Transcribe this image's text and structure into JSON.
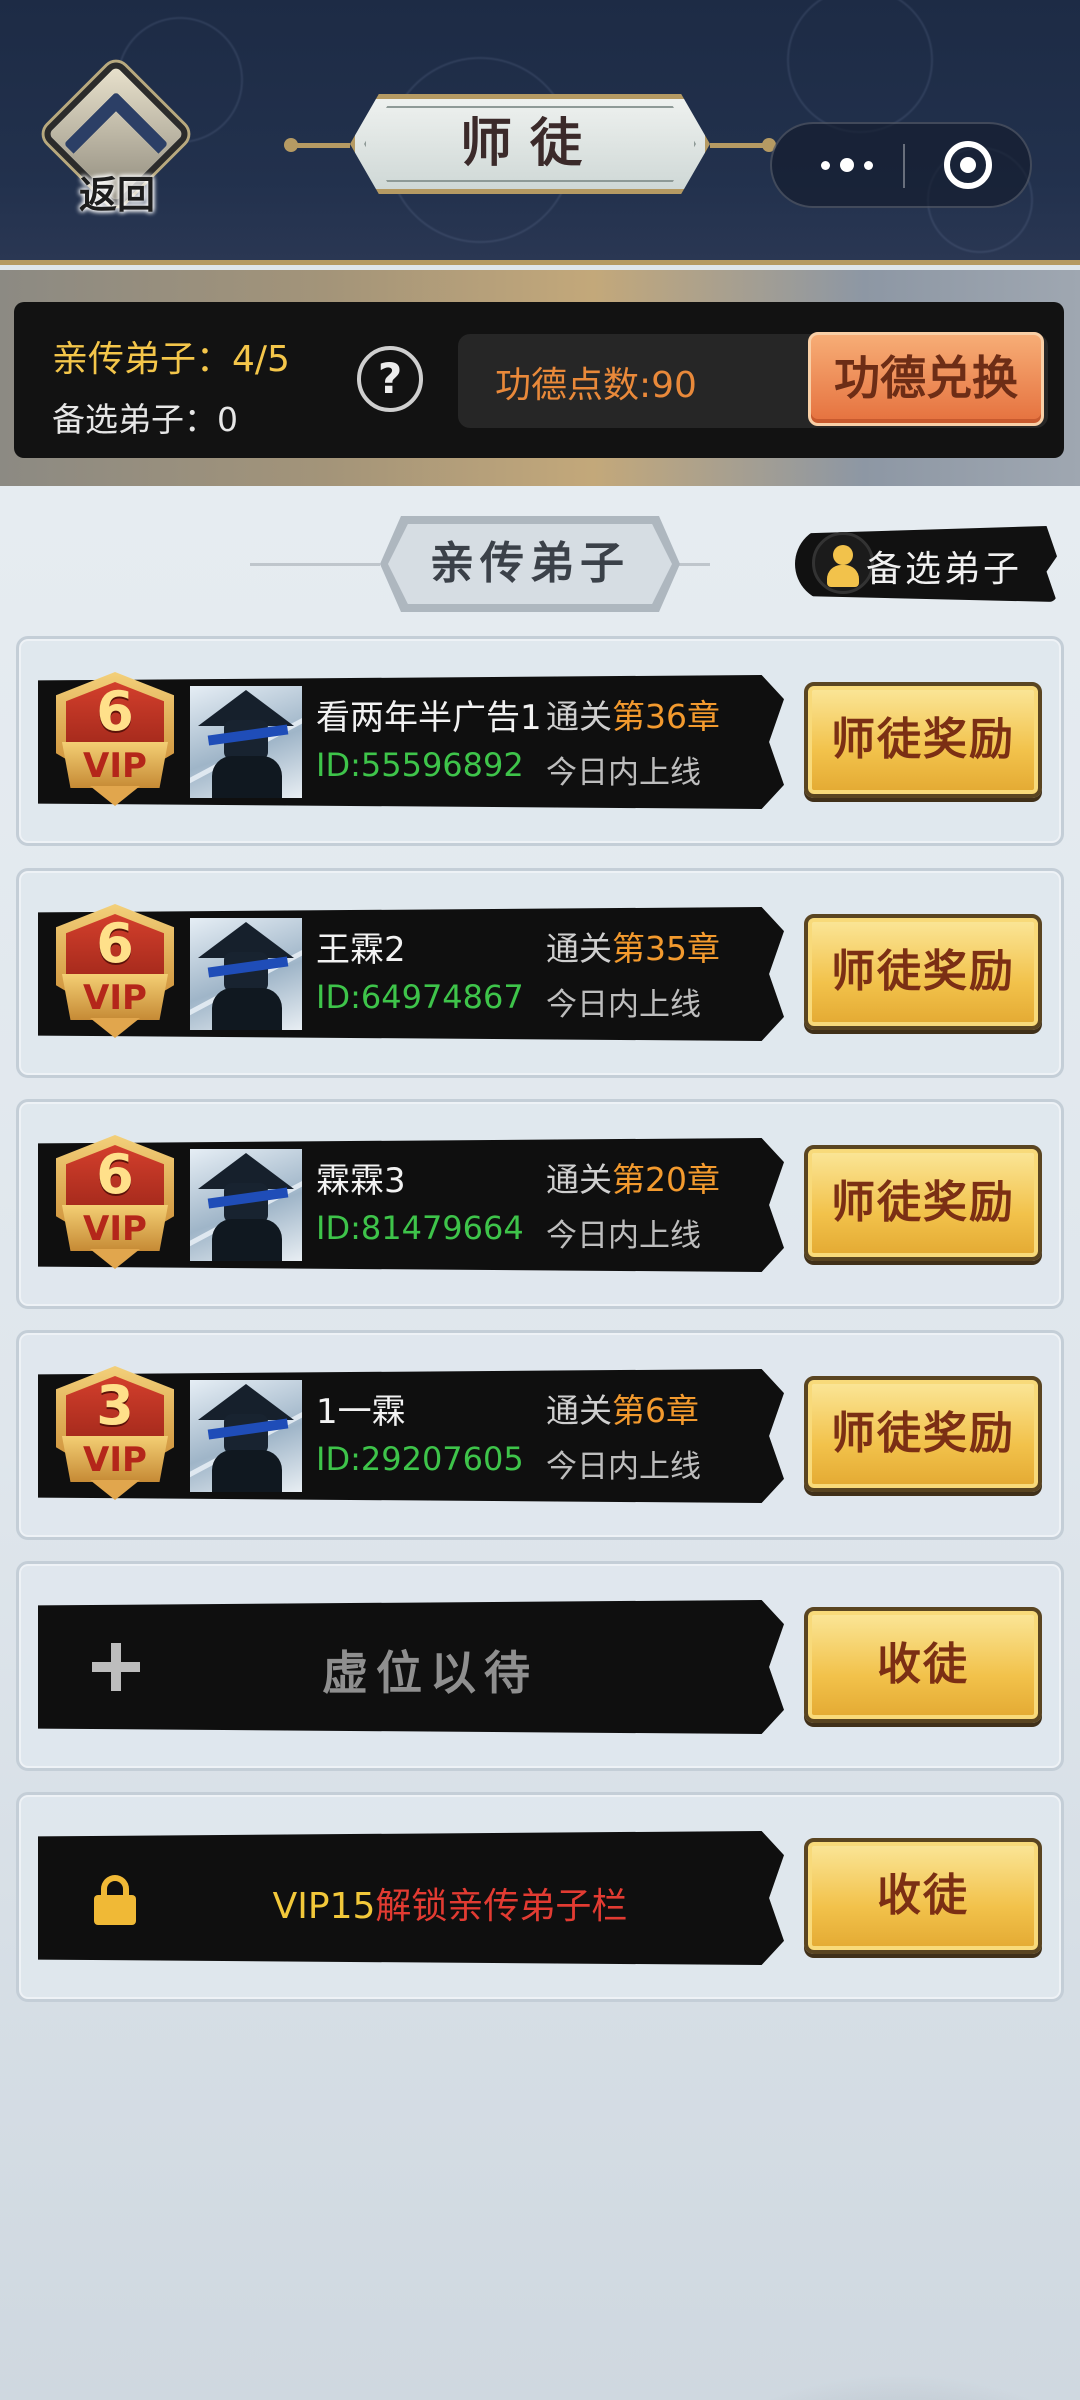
{
  "header": {
    "back_label": "返回",
    "title": "师徒"
  },
  "info": {
    "direct_label": "亲传弟子：",
    "direct_count": "4/5",
    "standby_label": "备选弟子：",
    "standby_count": "0",
    "help": "?",
    "merit_label": "功德点数:",
    "merit_value": "90",
    "exchange_button": "功德兑换"
  },
  "section": {
    "title": "亲传弟子",
    "standby_button": "备选弟子"
  },
  "disciples": [
    {
      "vip_level": "6",
      "vip_text": "VIP",
      "name": "看两年半广告1",
      "id": "ID:55596892",
      "progress_prefix": "通关",
      "chapter": "第36章",
      "online": "今日内上线",
      "button": "师徒奖励"
    },
    {
      "vip_level": "6",
      "vip_text": "VIP",
      "name": "王霖2",
      "id": "ID:64974867",
      "progress_prefix": "通关",
      "chapter": "第35章",
      "online": "今日内上线",
      "button": "师徒奖励"
    },
    {
      "vip_level": "6",
      "vip_text": "VIP",
      "name": "霖霖3",
      "id": "ID:81479664",
      "progress_prefix": "通关",
      "chapter": "第20章",
      "online": "今日内上线",
      "button": "师徒奖励"
    },
    {
      "vip_level": "3",
      "vip_text": "VIP",
      "name": "1一霖",
      "id": "ID:29207605",
      "progress_prefix": "通关",
      "chapter": "第6章",
      "online": "今日内上线",
      "button": "师徒奖励"
    }
  ],
  "empty_slot": {
    "text": "虚位以待",
    "button": "收徒"
  },
  "locked_slot": {
    "vip": "VIP15",
    "text": "解锁亲传弟子栏",
    "button": "收徒"
  },
  "colors": {
    "header_bg": "#1d2b45",
    "gold": "#f2c24b",
    "green_id": "#3ec44a",
    "orange_chapter": "#f39a2e",
    "exchange_orange": "#e5713e",
    "lock_red": "#e23b32"
  }
}
